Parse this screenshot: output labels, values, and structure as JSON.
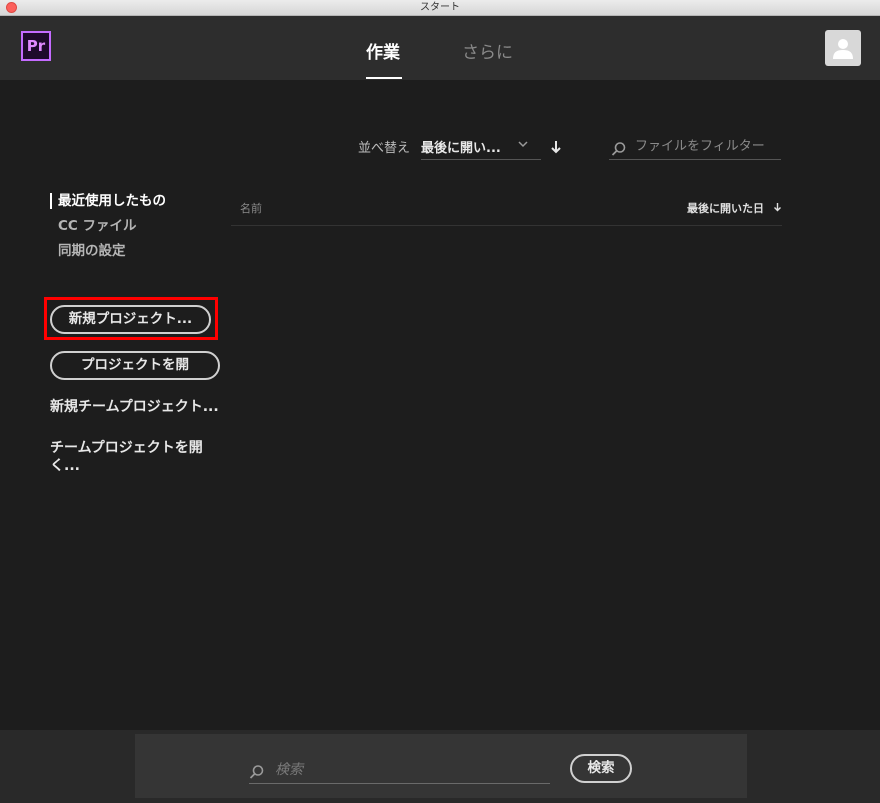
{
  "window": {
    "title": "スタート"
  },
  "header": {
    "logo_text": "Pr",
    "tabs": [
      {
        "label": "作業",
        "active": true
      },
      {
        "label": "さらに",
        "active": false
      }
    ]
  },
  "toolbar": {
    "sort_label": "並べ替え",
    "sort_value": "最後に開い...",
    "filter_placeholder": "ファイルをフィルター"
  },
  "sidebar": {
    "nav": [
      {
        "label": "最近使用したもの",
        "active": true
      },
      {
        "label": "CC ファイル",
        "active": false
      },
      {
        "label": "同期の設定",
        "active": false
      }
    ],
    "new_project_label": "新規プロジェクト...",
    "open_project_label": "プロジェクトを開",
    "new_team_project_label": "新規チームプロジェクト...",
    "open_team_project_label": "チームプロジェクトを開く..."
  },
  "file_list": {
    "columns": {
      "name": "名前",
      "last_opened": "最後に開いた日"
    },
    "rows": []
  },
  "footer": {
    "search_placeholder": "検索",
    "search_button": "検索"
  },
  "colors": {
    "background": "#1d1d1d",
    "topbar": "#2d2d2d",
    "accent_purple": "#c46bff",
    "highlight_red": "#ff0000"
  },
  "icons": [
    "close-dot",
    "premiere-logo",
    "user-avatar-icon",
    "chevron-down-icon",
    "arrow-down-icon",
    "search-icon"
  ]
}
